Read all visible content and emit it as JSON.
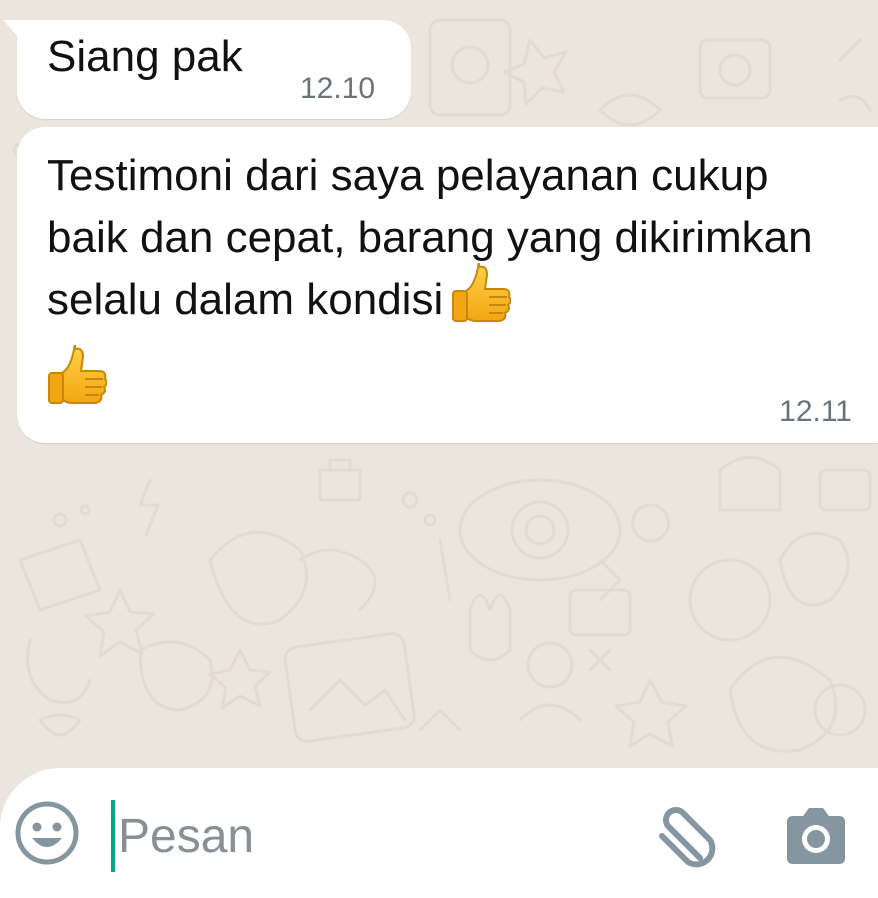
{
  "messages": [
    {
      "text": "Siang pak",
      "time": "12.10"
    },
    {
      "text": "Testimoni dari saya pelayanan cukup baik dan cepat, barang yang dikirimkan selalu dalam kondisi",
      "emojis": [
        "thumbs-up-icon",
        "thumbs-up-icon"
      ],
      "time": "12.11"
    }
  ],
  "input": {
    "placeholder": "Pesan"
  },
  "icons": {
    "emoji_button": "smiley-icon",
    "attach_button": "paperclip-icon",
    "camera_button": "camera-icon"
  },
  "colors": {
    "background": "#ece5dd",
    "bubble": "#ffffff",
    "cursor": "#00a884",
    "icon": "#8696a0"
  }
}
